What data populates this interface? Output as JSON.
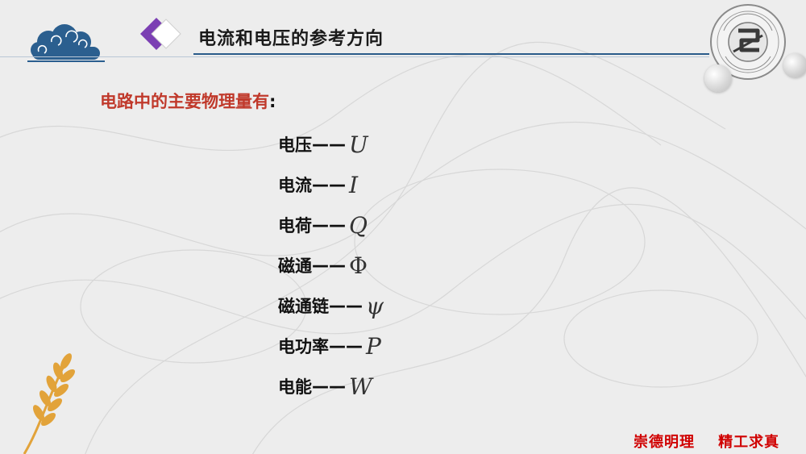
{
  "header": {
    "title": "电流和电压的参考方向"
  },
  "content": {
    "heading": "电路中的主要物理量有",
    "heading_colon": ":",
    "items": [
      {
        "label": "电压",
        "dash": "——",
        "symbol": "U"
      },
      {
        "label": "电流",
        "dash": "——",
        "symbol": "I"
      },
      {
        "label": "电荷",
        "dash": "—— ",
        "symbol": "Q"
      },
      {
        "label": "磁通",
        "dash": "——",
        "symbol": "Φ"
      },
      {
        "label": "磁通链",
        "dash": "——",
        "symbol": "ψ"
      },
      {
        "label": "电功率",
        "dash": "——",
        "symbol": "P"
      },
      {
        "label": "电能",
        "dash": "——",
        "symbol": "W"
      }
    ]
  },
  "footer": {
    "motto": "崇德明理    精工求真"
  },
  "colors": {
    "heading": "#c0392b",
    "motto": "#d00000",
    "accent_line": "#2a5b8a",
    "cloud": "#2b5f8f",
    "wheat": "#e2a33a"
  }
}
